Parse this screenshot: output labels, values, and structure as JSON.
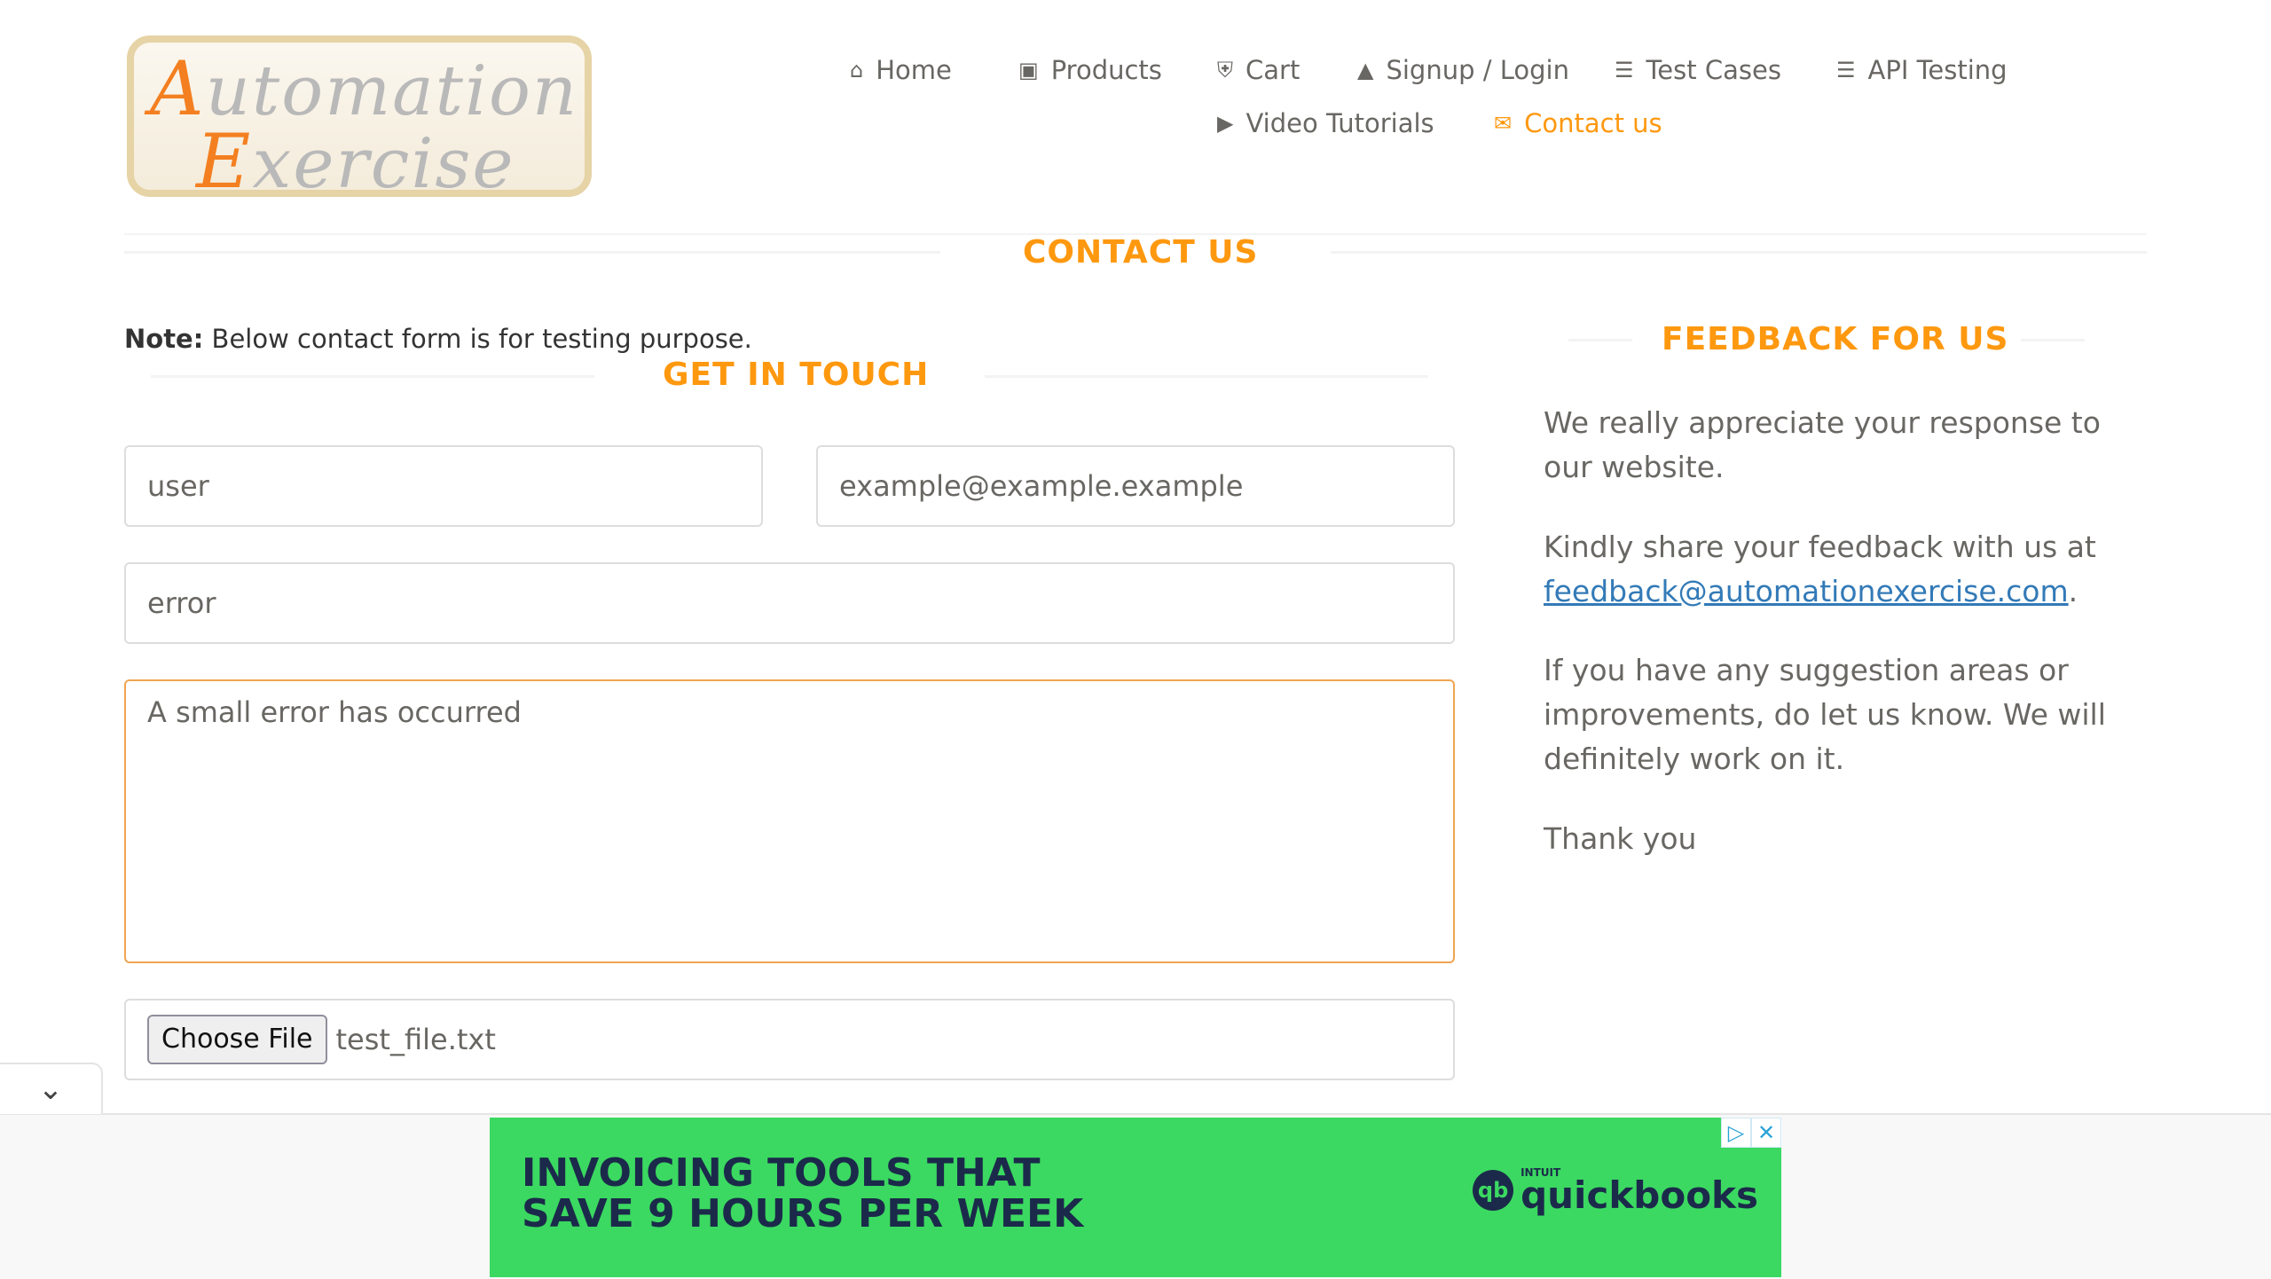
{
  "logo": {
    "line1_cap": "A",
    "line1_rest": "utomation",
    "line2_cap": "E",
    "line2_rest": "xercise"
  },
  "nav": {
    "home": {
      "icon": "home-icon",
      "label": "Home"
    },
    "products": {
      "icon": "briefcase-icon",
      "label": "Products"
    },
    "cart": {
      "icon": "cart-icon",
      "label": "Cart"
    },
    "signup": {
      "icon": "lock-icon",
      "label": "Signup / Login"
    },
    "test_cases": {
      "icon": "list-icon",
      "label": "Test Cases"
    },
    "api_testing": {
      "icon": "list-icon",
      "label": "API Testing"
    },
    "video": {
      "icon": "youtube-play-icon",
      "label": "Video Tutorials"
    },
    "contact": {
      "icon": "envelope-icon",
      "label": "Contact us"
    }
  },
  "page_title": "CONTACT US",
  "note": {
    "bold": "Note:",
    "text": "Below contact form is for testing purpose."
  },
  "form": {
    "title": "GET IN TOUCH",
    "name_value": "user",
    "email_value": "example@example.example",
    "subject_value": "error",
    "message_value": "A small error has occurred",
    "file_button": "Choose File",
    "file_name": "test_file.txt"
  },
  "feedback": {
    "title": "FEEDBACK FOR US",
    "p1": "We really appreciate your response to our website.",
    "p2_prefix": "Kindly share your feedback with us at",
    "email": "feedback@automationexercise.com",
    "p2_suffix": ".",
    "p3": "If you have any suggestion areas or improvements, do let us know. We will definitely work on it.",
    "p4": "Thank you"
  },
  "ad": {
    "line1": "INVOICING TOOLS THAT",
    "line2": "SAVE 9 HOURS PER WEEK",
    "brand_small": "INTUIT",
    "brand": "quickbooks",
    "colors": {
      "background": "#3bd961",
      "text": "#1b2a4a"
    }
  },
  "colors": {
    "accent": "#fe980f",
    "text": "#696763",
    "link": "#337ab7"
  }
}
